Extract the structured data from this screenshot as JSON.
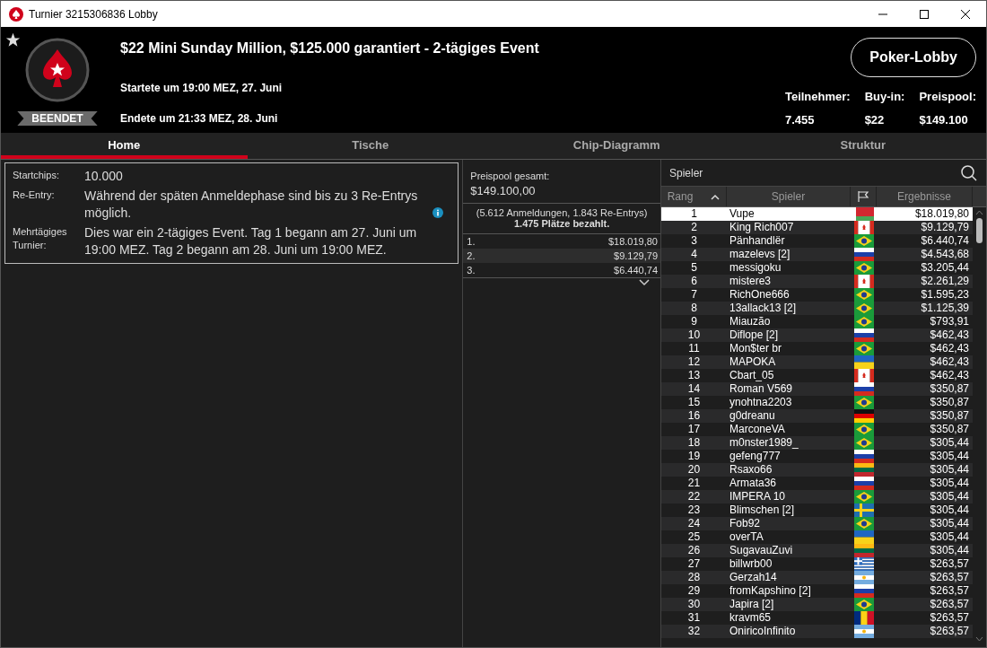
{
  "window": {
    "title": "Turnier 3215306836 Lobby"
  },
  "header": {
    "status": "BEENDET",
    "title": "$22 Mini Sunday Million, $125.000 garantiert - 2-tägiges Event",
    "started": "Startete um 19:00 MEZ, 27. Juni",
    "ended": "Endete um 21:33 MEZ, 28. Juni",
    "lobby_button": "Poker-Lobby",
    "stats": [
      {
        "label": "Teilnehmer:",
        "value": "7.455"
      },
      {
        "label": "Buy-in:",
        "value": "$22"
      },
      {
        "label": "Preispool:",
        "value": "$149.100"
      }
    ]
  },
  "tabs": [
    {
      "label": "Home",
      "selected": true
    },
    {
      "label": "Tische",
      "selected": false
    },
    {
      "label": "Chip-Diagramm",
      "selected": false
    },
    {
      "label": "Struktur",
      "selected": false
    }
  ],
  "details": [
    {
      "label": "Startchips:",
      "value": "10.000",
      "info": false
    },
    {
      "label": "Re-Entry:",
      "value": "Während der späten Anmeldephase sind bis zu 3 Re-Entrys möglich.",
      "info": true
    },
    {
      "label": "Mehrtägiges Turnier:",
      "value": "Dies war ein 2-tägiges Event. Tag 1 begann am 27. Juni um 19:00 MEZ. Tag 2 begann am 28. Juni um 19:00 MEZ.",
      "info": false
    }
  ],
  "prizepool": {
    "label": "Preispool gesamt:",
    "total": "$149.100,00",
    "entries": "(5.612 Anmeldungen, 1.843 Re-Entrys)",
    "paid": "1.475 Plätze bezahlt.",
    "payouts": [
      {
        "place": "1.",
        "amount": "$18.019,80"
      },
      {
        "place": "2.",
        "amount": "$9.129,79"
      },
      {
        "place": "3.",
        "amount": "$6.440,74"
      }
    ]
  },
  "players": {
    "search_label": "Spieler",
    "columns": [
      {
        "label": "Rang",
        "sorted": true
      },
      {
        "label": "Spieler",
        "sorted": false
      },
      {
        "label": "Ergebnisse",
        "sorted": false
      }
    ],
    "rows": [
      {
        "rank": "1",
        "name": "Vupe",
        "kind": "by",
        "result": "$18.019,80",
        "selected": true
      },
      {
        "rank": "2",
        "name": "King Rich007",
        "kind": "ca",
        "result": "$9.129,79",
        "selected": false
      },
      {
        "rank": "3",
        "name": "Pänhandlër",
        "kind": "br",
        "result": "$6.440,74",
        "selected": false
      },
      {
        "rank": "4",
        "name": "mazelevs [2]",
        "kind": "ru",
        "result": "$4.543,68",
        "selected": false
      },
      {
        "rank": "5",
        "name": "messigoku",
        "kind": "br",
        "result": "$3.205,44",
        "selected": false
      },
      {
        "rank": "6",
        "name": "mistere3",
        "kind": "ca",
        "result": "$2.261,29",
        "selected": false
      },
      {
        "rank": "7",
        "name": "RichOne666",
        "kind": "br",
        "result": "$1.595,23",
        "selected": false
      },
      {
        "rank": "8",
        "name": "13allack13 [2]",
        "kind": "br",
        "result": "$1.125,39",
        "selected": false
      },
      {
        "rank": "9",
        "name": "Miauzão",
        "kind": "br",
        "result": "$793,91",
        "selected": false
      },
      {
        "rank": "10",
        "name": "Diflope [2]",
        "kind": "ru",
        "result": "$462,43",
        "selected": false
      },
      {
        "rank": "11",
        "name": "Mon$ter br",
        "kind": "br",
        "result": "$462,43",
        "selected": false
      },
      {
        "rank": "12",
        "name": "MAPOKA",
        "kind": "ua",
        "result": "$462,43",
        "selected": false
      },
      {
        "rank": "13",
        "name": "Cbart_05",
        "kind": "ca",
        "result": "$462,43",
        "selected": false
      },
      {
        "rank": "14",
        "name": "Roman V569",
        "kind": "ru",
        "result": "$350,87",
        "selected": false
      },
      {
        "rank": "15",
        "name": "ynohtna2203",
        "kind": "br",
        "result": "$350,87",
        "selected": false
      },
      {
        "rank": "16",
        "name": "g0dreanu",
        "kind": "de",
        "result": "$350,87",
        "selected": false
      },
      {
        "rank": "17",
        "name": "MarconeVA",
        "kind": "br",
        "result": "$350,87",
        "selected": false
      },
      {
        "rank": "18",
        "name": "m0nster1989_",
        "kind": "br",
        "result": "$305,44",
        "selected": false
      },
      {
        "rank": "19",
        "name": "gefeng777",
        "kind": "ru",
        "result": "$305,44",
        "selected": false
      },
      {
        "rank": "20",
        "name": "Rsaxo66",
        "kind": "lt",
        "result": "$305,44",
        "selected": false
      },
      {
        "rank": "21",
        "name": "Armata36",
        "kind": "ru",
        "result": "$305,44",
        "selected": false
      },
      {
        "rank": "22",
        "name": "IMPERA 10",
        "kind": "br",
        "result": "$305,44",
        "selected": false
      },
      {
        "rank": "23",
        "name": "Blimschen [2]",
        "kind": "se",
        "result": "$305,44",
        "selected": false
      },
      {
        "rank": "24",
        "name": "Fob92",
        "kind": "br",
        "result": "$305,44",
        "selected": false
      },
      {
        "rank": "25",
        "name": "overTA",
        "kind": "ua",
        "result": "$305,44",
        "selected": false
      },
      {
        "rank": "26",
        "name": "SugavauZuvi",
        "kind": "lt",
        "result": "$305,44",
        "selected": false
      },
      {
        "rank": "27",
        "name": "billwrb00",
        "kind": "gr",
        "result": "$263,57",
        "selected": false
      },
      {
        "rank": "28",
        "name": "Gerzah14",
        "kind": "ar",
        "result": "$263,57",
        "selected": false
      },
      {
        "rank": "29",
        "name": "fromKapshino [2]",
        "kind": "ru",
        "result": "$263,57",
        "selected": false
      },
      {
        "rank": "30",
        "name": "Japira [2]",
        "kind": "br",
        "result": "$263,57",
        "selected": false
      },
      {
        "rank": "31",
        "name": "kravm65",
        "kind": "ro",
        "result": "$263,57",
        "selected": false
      },
      {
        "rank": "32",
        "name": "OniricoInfinito",
        "kind": "ar",
        "result": "$263,57",
        "selected": false
      }
    ]
  }
}
